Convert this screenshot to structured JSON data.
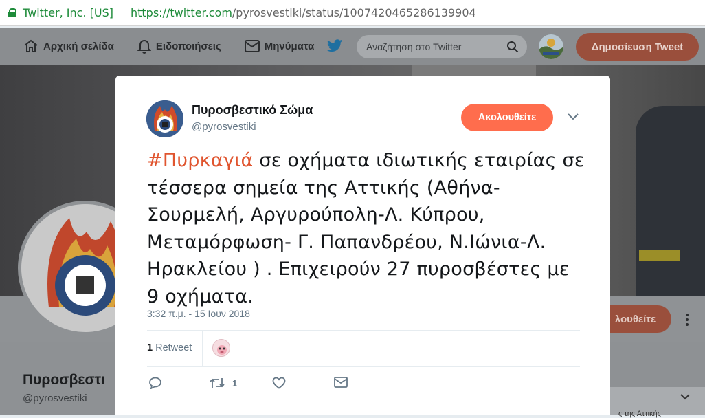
{
  "browser": {
    "site_identity": "Twitter, Inc. [US]",
    "url_host": "https://twitter.com",
    "url_path": "/pyrosvestiki/status/1007420465286139904"
  },
  "nav": {
    "home": "Αρχική σελίδα",
    "notifications": "Ειδοποιήσεις",
    "messages": "Μηνύματα",
    "search_placeholder": "Αναζήτηση στο Twitter",
    "tweet_button": "Δημοσίευση Tweet"
  },
  "profile": {
    "name": "Πυροσβεστι",
    "handle": "@pyrosvestiki",
    "follow_partial": "λουθείτε",
    "sidebar_snippet": "ς της Αττικής"
  },
  "tweet": {
    "author_name": "Πυροσβεστικό Σώμα",
    "author_handle": "@pyrosvestiki",
    "follow_label": "Ακολουθείτε",
    "hashtag": "#Πυρκαγιά",
    "body": " σε οχήματα ιδιωτικής εταιρίας σε τέσσερα σημεία της Αττικής (Αθήνα-Σουρμελή, Αργυρούπολη-Λ. Κύπρου, Μεταμόρφωση- Γ. Παπανδρέου, Ν.Ιώνια-Λ. Ηρακλείου ) . Επιχειρούν 27 πυροσβέστες με 9 οχήματα.",
    "timestamp": "3:32 π.μ. - 15 Ιουν 2018",
    "retweet_count": "1",
    "retweet_label": "Retweet",
    "action_retweet_count": "1"
  },
  "colors": {
    "accent": "#ff6d4d",
    "hashtag": "#e0552f",
    "secure_green": "#1e8b3a"
  }
}
